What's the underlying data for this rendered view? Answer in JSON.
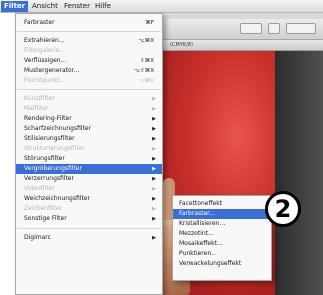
{
  "menubar": {
    "items": [
      "Filter",
      "Ansicht",
      "Fenster",
      "Hilfe"
    ],
    "active_index": 0
  },
  "window": {
    "doc_title_fragment": "(CMYK/8)"
  },
  "filter_menu": {
    "items": [
      {
        "label": "Farbraster",
        "shortcut": "⌘F",
        "disabled": false,
        "arrow": false
      },
      {
        "label": "Extrahieren...",
        "shortcut": "⌥⌘X",
        "disabled": false,
        "arrow": false
      },
      {
        "label": "Filtergalerie...",
        "shortcut": "",
        "disabled": true,
        "arrow": false
      },
      {
        "label": "Verflüssigen...",
        "shortcut": "⇧⌘X",
        "disabled": false,
        "arrow": false
      },
      {
        "label": "Mustergenerator...",
        "shortcut": "⌥⇧⌘X",
        "disabled": false,
        "arrow": false
      },
      {
        "label": "Fluchtpunkt...",
        "shortcut": "⌥⌘V",
        "disabled": true,
        "arrow": false
      },
      {
        "label": "Kunstfilter",
        "shortcut": "",
        "disabled": true,
        "arrow": true
      },
      {
        "label": "Malfilter",
        "shortcut": "",
        "disabled": true,
        "arrow": true
      },
      {
        "label": "Rendering-Filter",
        "shortcut": "",
        "disabled": false,
        "arrow": true
      },
      {
        "label": "Scharfzeichnungsfilter",
        "shortcut": "",
        "disabled": false,
        "arrow": true
      },
      {
        "label": "Stilisierungsfilter",
        "shortcut": "",
        "disabled": false,
        "arrow": true
      },
      {
        "label": "Strukturierungsfilter",
        "shortcut": "",
        "disabled": true,
        "arrow": true
      },
      {
        "label": "Störungsfilter",
        "shortcut": "",
        "disabled": false,
        "arrow": true
      },
      {
        "label": "Vergröberungsfilter",
        "shortcut": "",
        "disabled": false,
        "arrow": true,
        "highlighted": true
      },
      {
        "label": "Verzerrungsfilter",
        "shortcut": "",
        "disabled": false,
        "arrow": true
      },
      {
        "label": "Videofilter",
        "shortcut": "",
        "disabled": true,
        "arrow": true
      },
      {
        "label": "Weichzeichnungsfilter",
        "shortcut": "",
        "disabled": false,
        "arrow": true
      },
      {
        "label": "Zeichenfilter",
        "shortcut": "",
        "disabled": true,
        "arrow": true
      },
      {
        "label": "Sonstige Filter",
        "shortcut": "",
        "disabled": false,
        "arrow": true
      },
      {
        "label": "Digimarc",
        "shortcut": "",
        "disabled": false,
        "arrow": true
      }
    ]
  },
  "submenu": {
    "items": [
      {
        "label": "Facettoneffekt",
        "highlighted": false
      },
      {
        "label": "Farbraster...",
        "highlighted": true
      },
      {
        "label": "Kristallisieren...",
        "highlighted": false
      },
      {
        "label": "Mezzotint...",
        "highlighted": false
      },
      {
        "label": "Mosaikeffekt...",
        "highlighted": false
      },
      {
        "label": "Punktieren...",
        "highlighted": false
      },
      {
        "label": "Verwackelungseffekt",
        "highlighted": false
      }
    ]
  },
  "callout": {
    "step_number": "2"
  },
  "colors": {
    "highlight": "#3a6fd8",
    "canvas_red": "#c9302a"
  }
}
